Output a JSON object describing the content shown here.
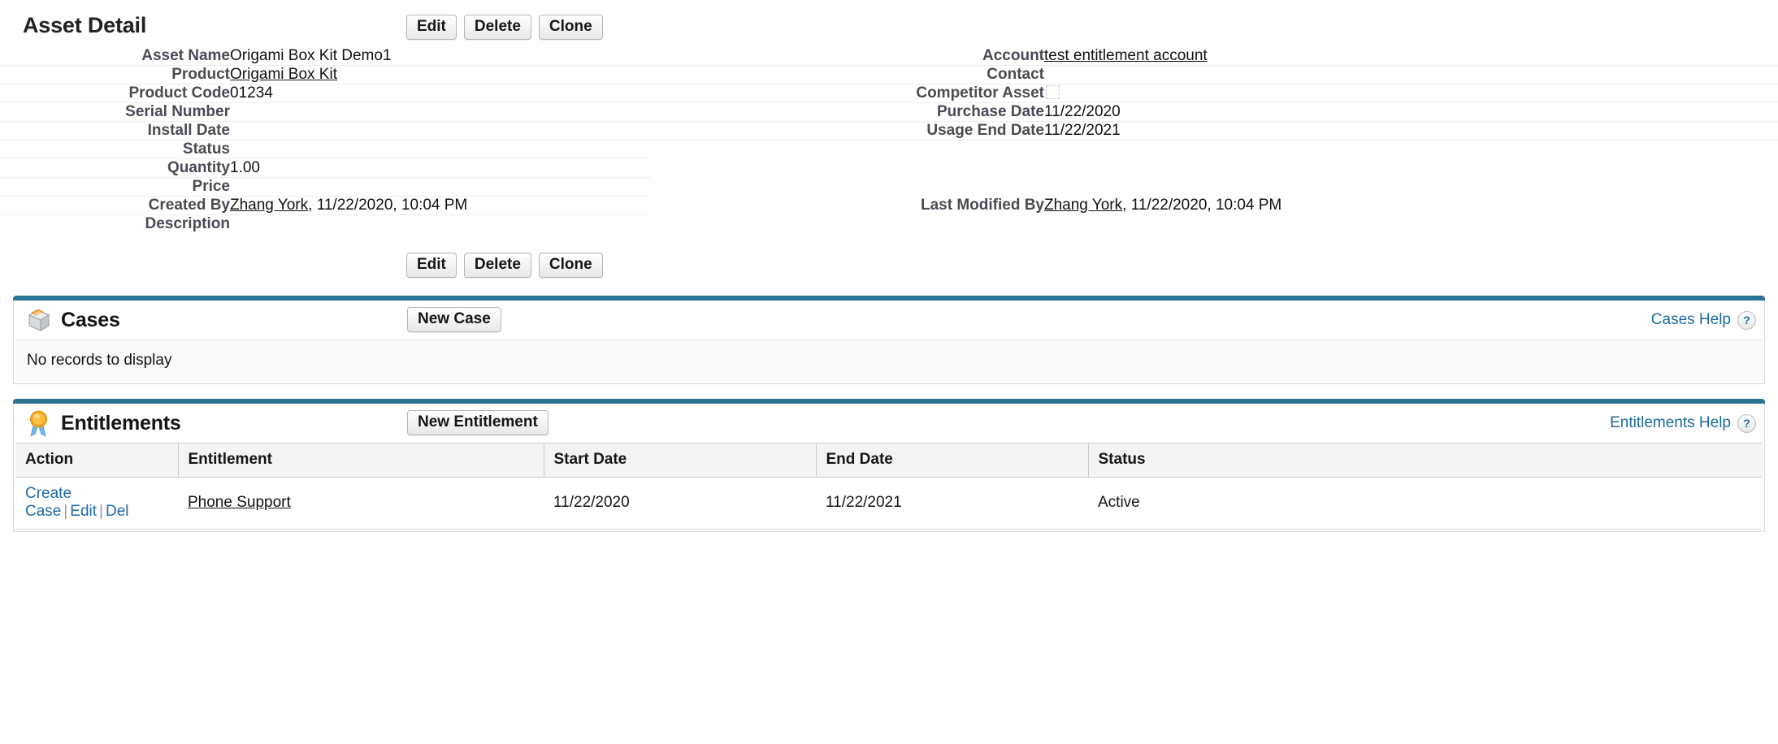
{
  "page": {
    "title": "Asset Detail"
  },
  "toolbar": {
    "edit_label": "Edit",
    "delete_label": "Delete",
    "clone_label": "Clone"
  },
  "detail": {
    "rows": [
      {
        "left_label": "Asset Name",
        "left_value": "Origami Box Kit Demo1",
        "left_link": false,
        "right_label": "Account",
        "right_value": "test entitlement account",
        "right_link": true
      },
      {
        "left_label": "Product",
        "left_value": "Origami Box Kit",
        "left_link": true,
        "right_label": "Contact",
        "right_value": "",
        "right_link": false
      },
      {
        "left_label": "Product Code",
        "left_value": "01234",
        "left_link": false,
        "right_label": "Competitor Asset",
        "right_value": "",
        "right_checkbox": true,
        "right_checked": false
      },
      {
        "left_label": "Serial Number",
        "left_value": "",
        "left_link": false,
        "right_label": "Purchase Date",
        "right_value": "11/22/2020",
        "right_link": false
      },
      {
        "left_label": "Install Date",
        "left_value": "",
        "left_link": false,
        "right_label": "Usage End Date",
        "right_value": "11/22/2021",
        "right_link": false
      },
      {
        "left_label": "Status",
        "left_value": "",
        "left_link": false,
        "right_label": "",
        "right_value": ""
      },
      {
        "left_label": "Quantity",
        "left_value": "1.00",
        "left_link": false,
        "right_label": "",
        "right_value": ""
      },
      {
        "left_label": "Price",
        "left_value": "",
        "left_link": false,
        "right_label": "",
        "right_value": ""
      },
      {
        "left_label": "Created By",
        "left_link_text": "Zhang York",
        "left_rest_text": ", 11/22/2020, 10:04 PM",
        "right_label": "Last Modified By",
        "right_link_text": "Zhang York",
        "right_rest_text": ", 11/22/2020, 10:04 PM"
      },
      {
        "left_label": "Description",
        "left_value": "",
        "left_link": false,
        "right_label": "",
        "right_value": ""
      }
    ]
  },
  "cases_section": {
    "title": "Cases",
    "icon": "case-folder-icon",
    "new_button_label": "New Case",
    "help_label": "Cases Help",
    "help_icon": "question-mark-icon",
    "empty_message": "No records to display"
  },
  "entitlements_section": {
    "title": "Entitlements",
    "icon": "award-ribbon-icon",
    "new_button_label": "New Entitlement",
    "help_label": "Entitlements Help",
    "help_icon": "question-mark-icon",
    "columns": [
      "Action",
      "Entitlement",
      "Start Date",
      "End Date",
      "Status"
    ],
    "rows": [
      {
        "actions": [
          "Create Case",
          "Edit",
          "Del"
        ],
        "entitlement": "Phone Support",
        "start_date": "11/22/2020",
        "end_date": "11/22/2021",
        "status": "Active"
      }
    ]
  },
  "colors": {
    "section_bar": "#2a7391",
    "link": "#1c6b9c",
    "label_text": "#4a4a56"
  }
}
